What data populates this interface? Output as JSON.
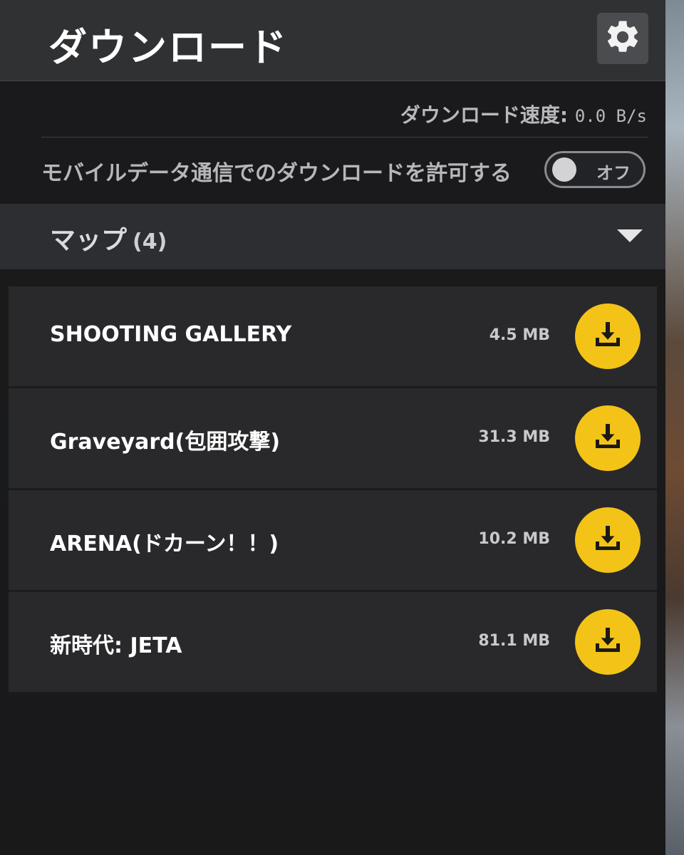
{
  "header": {
    "title": "ダウンロード",
    "settings_icon": "gear-icon"
  },
  "download_speed": {
    "label": "ダウンロード速度:",
    "value": "0.0 B/s"
  },
  "mobile_data": {
    "label": "モバイルデータ通信でのダウンロードを許可する",
    "toggle_state_label": "オフ",
    "enabled": false
  },
  "maps_section": {
    "title": "マップ",
    "count": "(4)",
    "expanded": true
  },
  "maps": [
    {
      "name": "SHOOTING GALLERY",
      "size": "4.5 MB"
    },
    {
      "name": "Graveyard(包囲攻撃)",
      "size": "31.3 MB"
    },
    {
      "name": "ARENA(ドカーン！！)",
      "size": "10.2 MB"
    },
    {
      "name": "新時代: JETA",
      "size": "81.1 MB"
    }
  ],
  "colors": {
    "accent": "#f3c417",
    "panel": "#29292c",
    "header": "#303133"
  }
}
